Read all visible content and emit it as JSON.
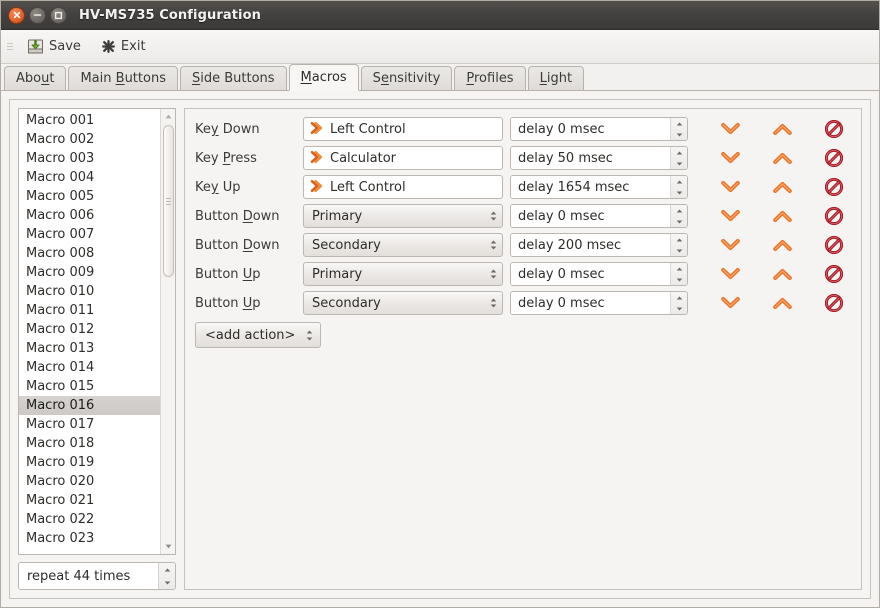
{
  "window": {
    "title": "HV-MS735 Configuration",
    "buttons": {
      "close": "close-window",
      "minimize": "minimize-window",
      "maximize": "maximize-window"
    }
  },
  "toolbar": {
    "save_label": "Save",
    "exit_label": "Exit"
  },
  "tabs": [
    {
      "label": "About",
      "mnemonic_index": 3,
      "active": false
    },
    {
      "label": "Main Buttons",
      "mnemonic_index": 5,
      "active": false
    },
    {
      "label": "Side Buttons",
      "mnemonic_index": 0,
      "active": false
    },
    {
      "label": "Macros",
      "mnemonic_index": 0,
      "active": true
    },
    {
      "label": "Sensitivity",
      "mnemonic_index": 1,
      "active": false
    },
    {
      "label": "Profiles",
      "mnemonic_index": 0,
      "active": false
    },
    {
      "label": "Light",
      "mnemonic_index": 0,
      "active": false
    }
  ],
  "macro_list": {
    "items": [
      "Macro 001",
      "Macro 002",
      "Macro 003",
      "Macro 004",
      "Macro 005",
      "Macro 006",
      "Macro 007",
      "Macro 008",
      "Macro 009",
      "Macro 010",
      "Macro 011",
      "Macro 012",
      "Macro 013",
      "Macro 014",
      "Macro 015",
      "Macro 016",
      "Macro 017",
      "Macro 018",
      "Macro 019",
      "Macro 020",
      "Macro 021",
      "Macro 022",
      "Macro 023"
    ],
    "selected": "Macro 016",
    "selected_index": 15
  },
  "repeat": {
    "value": "repeat 44 times"
  },
  "actions": [
    {
      "label": "Key Down",
      "mnemonic_index": 2,
      "field_type": "key",
      "value": "Left Control",
      "delay": "delay 0 msec"
    },
    {
      "label": "Key Press",
      "mnemonic_index": 4,
      "field_type": "key",
      "value": "Calculator",
      "delay": "delay 50 msec"
    },
    {
      "label": "Key Up",
      "mnemonic_index": 2,
      "field_type": "key",
      "value": "Left Control",
      "delay": "delay 1654 msec"
    },
    {
      "label": "Button Down",
      "mnemonic_index": 7,
      "field_type": "combo",
      "value": "Primary",
      "delay": "delay 0 msec"
    },
    {
      "label": "Button Down",
      "mnemonic_index": 7,
      "field_type": "combo",
      "value": "Secondary",
      "delay": "delay 200 msec"
    },
    {
      "label": "Button Up",
      "mnemonic_index": 7,
      "field_type": "combo",
      "value": "Primary",
      "delay": "delay 0 msec"
    },
    {
      "label": "Button Up",
      "mnemonic_index": 7,
      "field_type": "combo",
      "value": "Secondary",
      "delay": "delay 0 msec"
    }
  ],
  "row_icons": {
    "move_down": "chevron-down-icon",
    "move_up": "chevron-up-icon",
    "delete": "delete-forbidden-icon"
  },
  "add_action": {
    "label": "<add action>"
  },
  "colors": {
    "accent_orange": "#e8762c",
    "delete_red": "#a51c26",
    "titlebar": "#434140",
    "window_bg": "#f2f1f0",
    "selection": "#d5d2cf",
    "save_green": "#7cb342"
  }
}
